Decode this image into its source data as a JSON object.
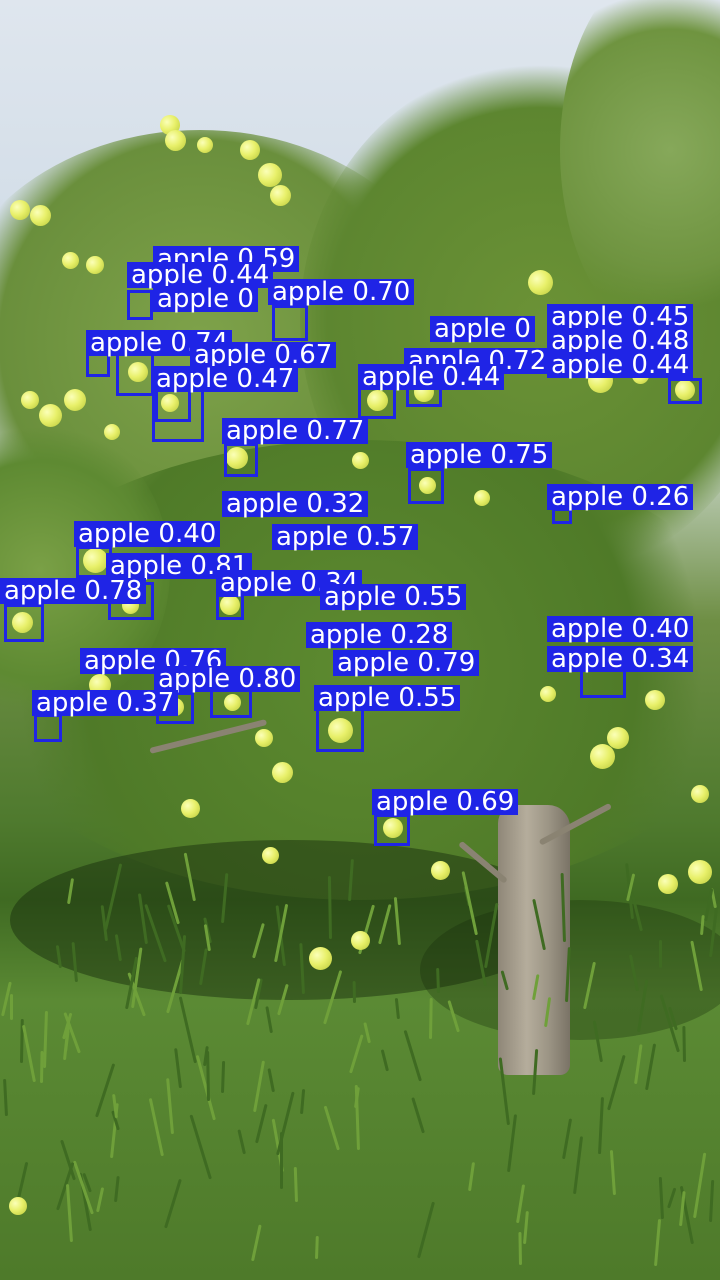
{
  "image": {
    "subject": "apple tree in orchard",
    "colors": {
      "box": "#1f24e6",
      "label_text": "#ffffff",
      "sky": "#dfe6ee",
      "foliage": "#4f7a2e",
      "fruit": "#e8f06a"
    }
  },
  "detections": [
    {
      "label": "apple 0.59"
    },
    {
      "label": "apple 0.44"
    },
    {
      "label": "apple 0.70"
    },
    {
      "label": "apple 0"
    },
    {
      "label": "apple 0.45"
    },
    {
      "label": "apple 0.48"
    },
    {
      "label": "apple 0.44"
    },
    {
      "label": "apple 0.74"
    },
    {
      "label": "apple 0.67"
    },
    {
      "label": "apple 0.72"
    },
    {
      "label": "apple 0.47"
    },
    {
      "label": "apple 0.77"
    },
    {
      "label": "apple 0.75"
    },
    {
      "label": "apple 0.26"
    },
    {
      "label": "apple 0.32"
    },
    {
      "label": "apple 0.40"
    },
    {
      "label": "apple 0.57"
    },
    {
      "label": "apple 0.81"
    },
    {
      "label": "apple 0.78"
    },
    {
      "label": "apple 0.34"
    },
    {
      "label": "apple 0.55"
    },
    {
      "label": "apple 0.28"
    },
    {
      "label": "apple 0.40"
    },
    {
      "label": "apple 0.76"
    },
    {
      "label": "apple 0.79"
    },
    {
      "label": "apple 0.34"
    },
    {
      "label": "apple 0.80"
    },
    {
      "label": "apple 0.37"
    },
    {
      "label": "apple 0.55"
    },
    {
      "label": "apple 0.69"
    }
  ]
}
